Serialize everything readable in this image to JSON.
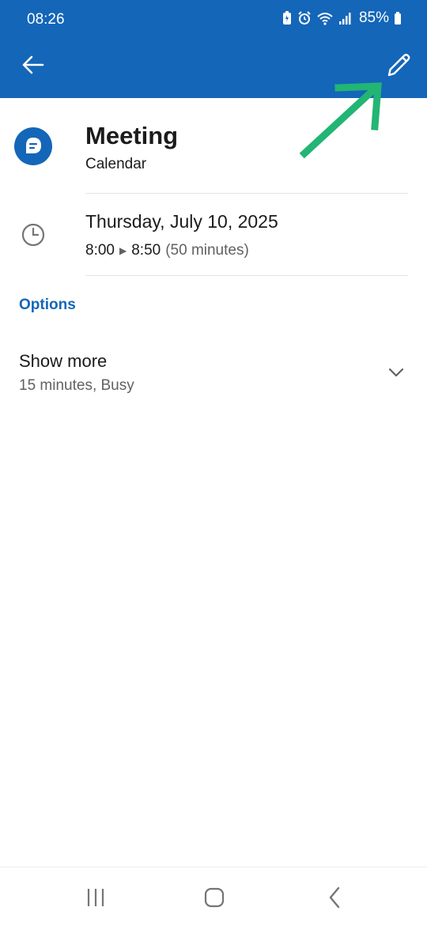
{
  "status_bar": {
    "time": "08:26",
    "battery": "85%"
  },
  "header": {
    "back_icon": "arrow-left-icon",
    "edit_icon": "pencil-icon",
    "bg_color": "#1466b8"
  },
  "event": {
    "title": "Meeting",
    "calendar": "Calendar",
    "date": "Thursday, July 10, 2025",
    "start": "8:00",
    "end": "8:50",
    "duration": "(50 minutes)"
  },
  "options": {
    "heading": "Options",
    "show_more_label": "Show more",
    "show_more_detail": "15 minutes, Busy"
  },
  "colors": {
    "accent": "#1466b8",
    "annotation_arrow": "#22b573"
  }
}
